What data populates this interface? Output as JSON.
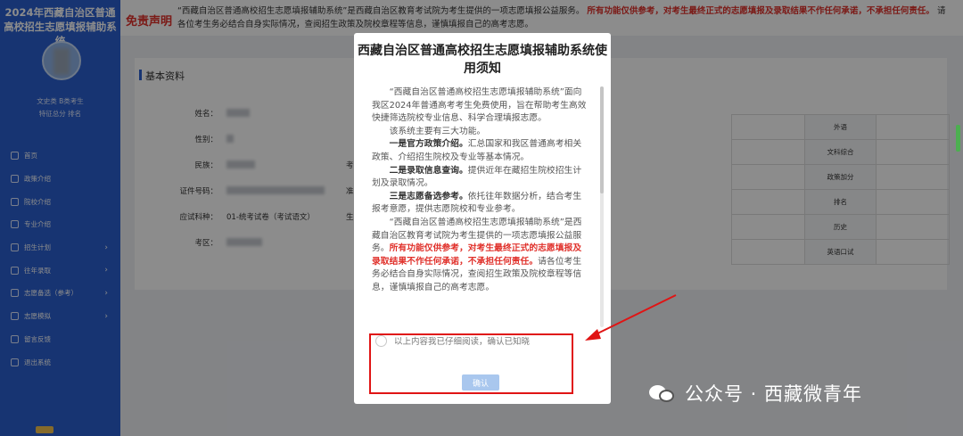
{
  "sidebar": {
    "title": "2024年西藏自治区普通高校招生志愿填报辅助系统",
    "info_line1": "文史类  B类考生",
    "info_line2": "特征总分  排名",
    "nav": [
      {
        "label": "首页",
        "icon": "home-icon",
        "arrow": false
      },
      {
        "label": "政策介绍",
        "icon": "document-icon",
        "arrow": false
      },
      {
        "label": "院校介绍",
        "icon": "school-icon",
        "arrow": false
      },
      {
        "label": "专业介绍",
        "icon": "book-icon",
        "arrow": false
      },
      {
        "label": "招生计划",
        "icon": "plan-icon",
        "arrow": true
      },
      {
        "label": "往年录取",
        "icon": "history-icon",
        "arrow": true
      },
      {
        "label": "志愿备选（参考）",
        "icon": "candidate-icon",
        "arrow": true
      },
      {
        "label": "志愿模拟",
        "icon": "simulate-icon",
        "arrow": true
      },
      {
        "label": "留言反馈",
        "icon": "feedback-icon",
        "arrow": false
      },
      {
        "label": "退出系统",
        "icon": "logout-icon",
        "arrow": false
      }
    ]
  },
  "banner": {
    "title": "免责声明",
    "text_plain_1": "“西藏自治区普通高校招生志愿填报辅助系统”是西藏自治区教育考试院为考生提供的一项志愿填报公益服务。",
    "text_red": "所有功能仅供参考，对考生最终正式的志愿填报及录取结果不作任何承诺，不承担任何责任。",
    "text_plain_2": "请各位考生务必结合自身实际情况，查阅招生政策及院校章程等信息，谨慎填报自己的高考志愿。"
  },
  "panel": {
    "title": "基本资料",
    "fields": [
      {
        "label": "姓名：",
        "value": ""
      },
      {
        "label": "性别：",
        "value": ""
      },
      {
        "label": "民族：",
        "value": ""
      },
      {
        "label": "证件号码：",
        "value": ""
      },
      {
        "label": "应试科种：",
        "value": "01-统考试卷（考试语文）"
      },
      {
        "label": "考区：",
        "value": ""
      }
    ],
    "mid_labels": [
      "考",
      "准",
      "生"
    ],
    "score_rows": [
      "外语",
      "文科综合",
      "政策加分",
      "排名",
      "历史",
      "英语口试"
    ]
  },
  "modal": {
    "title": "西藏自治区普通高校招生志愿填报辅助系统使用须知",
    "p1": "“西藏自治区普通高校招生志愿填报辅助系统”面向我区2024年普通高考考生免费使用，旨在帮助考生高效快捷筛选院校专业信息、科学合理填报志愿。",
    "p2": "该系统主要有三大功能。",
    "f1_title": "一是官方政策介绍。",
    "f1_text": "汇总国家和我区普通高考相关政策、介绍招生院校及专业等基本情况。",
    "f2_title": "二是录取信息查询。",
    "f2_text": "提供近年在藏招生院校招生计划及录取情况。",
    "f3_title": "三是志愿备选参考。",
    "f3_text": "依托往年数据分析，结合考生报考意愿，提供志愿院校和专业参考。",
    "p4_plain": "“西藏自治区普通高校招生志愿填报辅助系统”是西藏自治区教育考试院为考生提供的一项志愿填报公益服务。",
    "p4_red": "所有功能仅供参考，对考生最终正式的志愿填报及录取结果不作任何承诺，不承担任何责任。",
    "p4_tail": "请各位考生务必结合自身实际情况，查阅招生政策及院校章程等信息，谨慎填报自己的高考志愿。",
    "checkbox_label": "以上内容我已仔细阅读，确认已知晓",
    "confirm_label": "确认"
  },
  "watermark": {
    "text": "公众号 · 西藏微青年",
    "icon": "wechat-icon"
  },
  "colors": {
    "sidebar": "#2a5fcf",
    "accent_red": "#e0302a",
    "confirm_button": "#a9c7ee"
  }
}
